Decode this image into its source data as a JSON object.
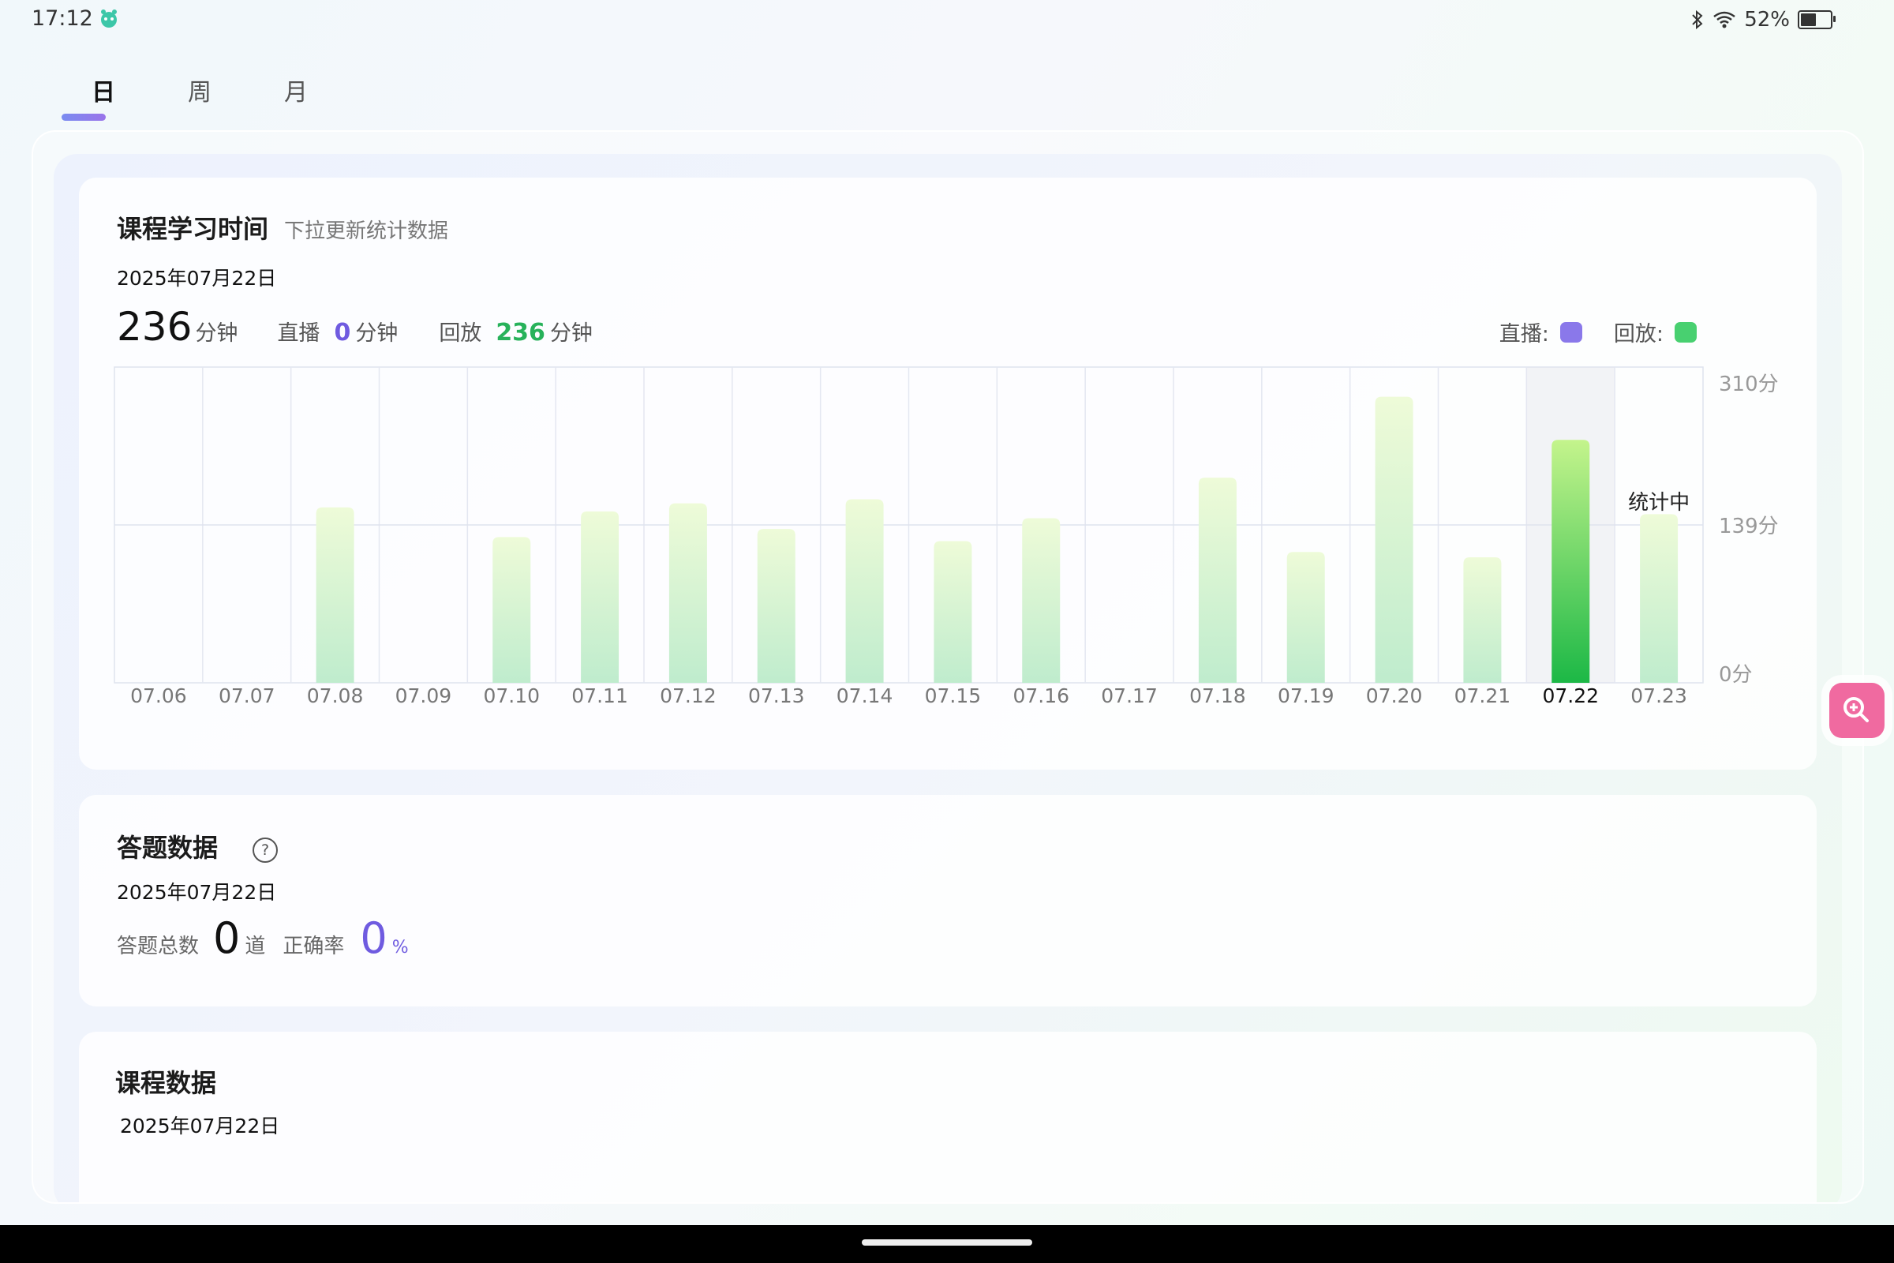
{
  "status_bar": {
    "time": "17:12",
    "battery": "52%",
    "battery_level": 0.52
  },
  "tabs": [
    {
      "label": "日",
      "active": true
    },
    {
      "label": "周",
      "active": false
    },
    {
      "label": "月",
      "active": false
    }
  ],
  "course_time": {
    "title": "课程学习时间",
    "subtitle": "下拉更新统计数据",
    "date": "2025年07月22日",
    "total_value": "236",
    "total_unit": "分钟",
    "live_label": "直播",
    "live_value": "0",
    "live_unit": "分钟",
    "replay_label": "回放",
    "replay_value": "236",
    "replay_unit": "分钟",
    "legend_live": "直播:",
    "legend_replay": "回放:",
    "colors": {
      "live": "#8a78ea",
      "replay": "#48d070"
    }
  },
  "chart_data": {
    "type": "bar",
    "categories": [
      "07.06",
      "07.07",
      "07.08",
      "07.09",
      "07.10",
      "07.11",
      "07.12",
      "07.13",
      "07.14",
      "07.15",
      "07.16",
      "07.17",
      "07.18",
      "07.19",
      "07.20",
      "07.21",
      "07.22",
      "07.23"
    ],
    "series": [
      {
        "values": [
          0,
          0,
          130,
          0,
          108,
          127,
          133,
          114,
          136,
          105,
          122,
          0,
          152,
          97,
          212,
          93,
          180,
          125
        ]
      }
    ],
    "yticks": [
      {
        "value": 0,
        "label": "0分"
      },
      {
        "value": 139,
        "label": "139分"
      },
      {
        "value": 310,
        "label": "310分"
      }
    ],
    "ylim": [
      0,
      234
    ],
    "selected_category": "07.22",
    "annotation": {
      "category": "07.23",
      "text": "统计中"
    },
    "grid": true
  },
  "answers": {
    "title": "答题数据",
    "help": "?",
    "date": "2025年07月22日",
    "total_label": "答题总数",
    "total_value": "0",
    "total_unit": "道",
    "accuracy_label": "正确率",
    "accuracy_value": "0",
    "accuracy_unit": "%"
  },
  "course_data": {
    "title": "课程数据",
    "date": "2025年07月22日"
  },
  "icons": {
    "bluetooth": "bluetooth-icon",
    "wifi": "wifi-icon",
    "battery": "battery-icon",
    "zoom": "zoom-in-icon",
    "app": "app-mascot-icon"
  }
}
